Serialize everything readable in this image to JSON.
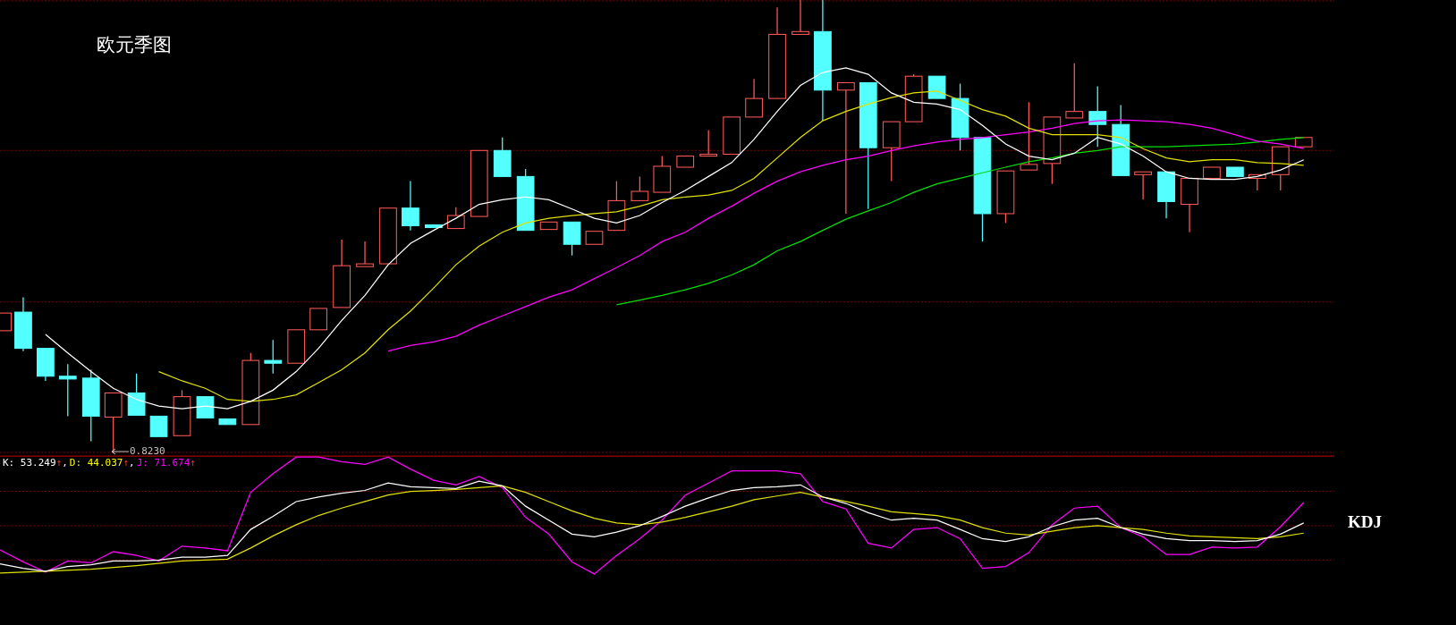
{
  "title": "欧元季图",
  "low_marker": {
    "value": "0.8230"
  },
  "indicator": {
    "name": "KDJ",
    "legend": [
      {
        "text": "K: 53.249",
        "arrow": "↑",
        "separator": ",",
        "color": "#ffffff"
      },
      {
        "text": "D: 44.037",
        "arrow": "↑",
        "separator": ",",
        "color": "#ffff00"
      },
      {
        "text": "J: 71.674",
        "arrow": "↑",
        "color": "#ff00ff"
      }
    ]
  }
}
